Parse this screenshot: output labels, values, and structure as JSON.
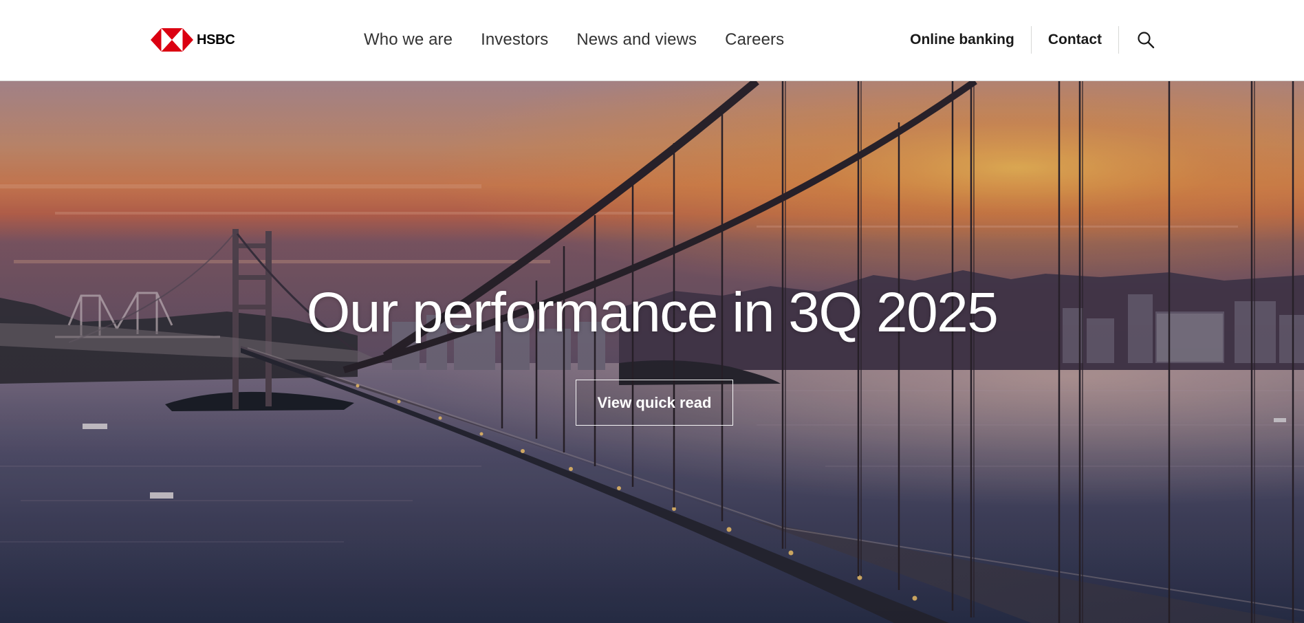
{
  "brand": {
    "name": "HSBC",
    "logo_red": "#db0011",
    "icon": "hsbc-hexagon-logo-icon"
  },
  "nav": {
    "items": [
      {
        "label": "Who we are"
      },
      {
        "label": "Investors"
      },
      {
        "label": "News and views"
      },
      {
        "label": "Careers"
      }
    ]
  },
  "utility": {
    "online_banking": "Online banking",
    "contact": "Contact",
    "search_icon": "search-icon"
  },
  "hero": {
    "title": "Our performance in 3Q 2025",
    "cta_label": "View quick read",
    "image": "sunset-suspension-bridge-photo"
  },
  "colors": {
    "header_bg": "#ffffff",
    "nav_text": "#333333",
    "divider": "#d7d8d6",
    "hero_text": "#ffffff"
  }
}
